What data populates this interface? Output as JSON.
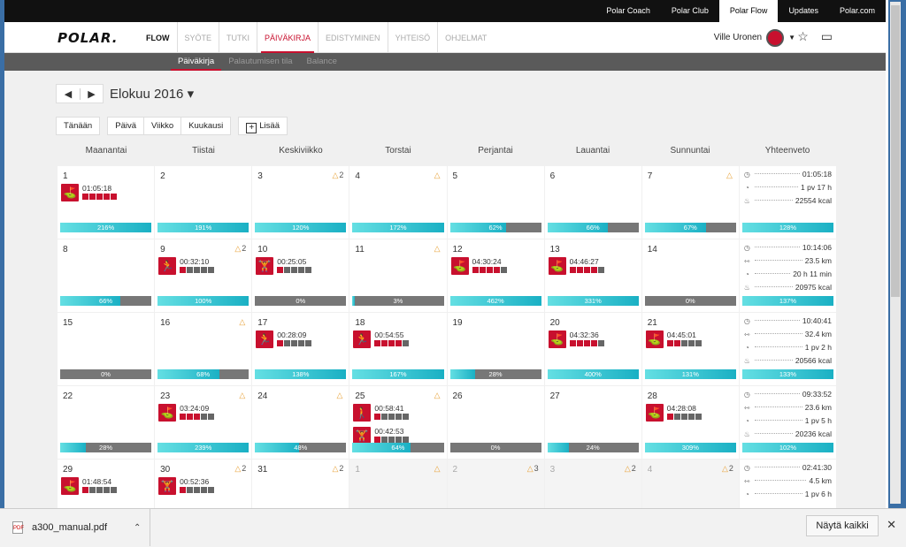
{
  "topbar": {
    "links": [
      {
        "label": "Polar Coach"
      },
      {
        "label": "Polar Club"
      },
      {
        "label": "Polar Flow",
        "active": true
      },
      {
        "label": "Updates"
      },
      {
        "label": "Polar.com"
      }
    ]
  },
  "header": {
    "logo": "POLAR.",
    "nav": [
      {
        "label": "FLOW"
      },
      {
        "label": "SYÖTE"
      },
      {
        "label": "TUTKI"
      },
      {
        "label": "PÄIVÄKIRJA",
        "active": true
      },
      {
        "label": "EDISTYMINEN"
      },
      {
        "label": "YHTEISÖ"
      },
      {
        "label": "OHJELMAT"
      }
    ],
    "user_name": "Ville Uronen"
  },
  "subnav": [
    {
      "label": "Päiväkirja",
      "active": true
    },
    {
      "label": "Palautumisen tila"
    },
    {
      "label": "Balance"
    }
  ],
  "month_title": "Elokuu 2016",
  "controls": {
    "today": "Tänään",
    "day": "Päivä",
    "week": "Viikko",
    "month": "Kuukausi",
    "add": "Lisää"
  },
  "weekdays": [
    "Maanantai",
    "Tiistai",
    "Keskiviikko",
    "Torstai",
    "Perjantai",
    "Lauantai",
    "Sunnuntai"
  ],
  "summary_header": "Yhteenveto",
  "weeks": [
    {
      "days": [
        {
          "day": "1",
          "sessions": [
            {
              "icon": "golf",
              "time": "01:05:18",
              "zones": 5
            }
          ],
          "bar": {
            "label": "216%",
            "fill": 1
          }
        },
        {
          "day": "2",
          "sessions": [],
          "bar": {
            "label": "191%",
            "fill": 1
          }
        },
        {
          "day": "3",
          "tri": "2",
          "sessions": [],
          "bar": {
            "label": "120%",
            "fill": 1
          }
        },
        {
          "day": "4",
          "tri": "",
          "sessions": [],
          "bar": {
            "label": "172%",
            "fill": 1
          }
        },
        {
          "day": "5",
          "sessions": [],
          "bar": {
            "label": "62%",
            "fill": 0.62
          }
        },
        {
          "day": "6",
          "sessions": [],
          "bar": {
            "label": "66%",
            "fill": 0.66
          }
        },
        {
          "day": "7",
          "tri": "",
          "sessions": [],
          "bar": {
            "label": "67%",
            "fill": 0.67
          }
        }
      ],
      "summary": [
        {
          "icon": "clock",
          "value": "01:05:18"
        },
        {
          "icon": "moon",
          "value": "1 pv 17 h"
        },
        {
          "icon": "flame",
          "value": "22554 kcal"
        }
      ],
      "summary_bar": {
        "label": "128%",
        "fill": 1
      }
    },
    {
      "days": [
        {
          "day": "8",
          "sessions": [],
          "bar": {
            "label": "66%",
            "fill": 0.66
          }
        },
        {
          "day": "9",
          "tri": "2",
          "sessions": [
            {
              "icon": "run",
              "time": "00:32:10",
              "zones": 1
            }
          ],
          "bar": {
            "label": "100%",
            "fill": 1
          }
        },
        {
          "day": "10",
          "sessions": [
            {
              "icon": "strength",
              "time": "00:25:05",
              "zones": 1
            }
          ],
          "bar": {
            "label": "0%",
            "fill": 0
          }
        },
        {
          "day": "11",
          "tri": "",
          "sessions": [],
          "bar": {
            "label": "3%",
            "fill": 0.03
          }
        },
        {
          "day": "12",
          "sessions": [
            {
              "icon": "golf",
              "time": "04:30:24",
              "zones": 4
            }
          ],
          "bar": {
            "label": "462%",
            "fill": 1
          }
        },
        {
          "day": "13",
          "sessions": [
            {
              "icon": "golf",
              "time": "04:46:27",
              "zones": 4
            }
          ],
          "bar": {
            "label": "331%",
            "fill": 1
          }
        },
        {
          "day": "14",
          "sessions": [],
          "bar": {
            "label": "0%",
            "fill": 0
          }
        }
      ],
      "summary": [
        {
          "icon": "clock",
          "value": "10:14:06"
        },
        {
          "icon": "distance",
          "value": "23.5 km"
        },
        {
          "icon": "moon",
          "value": "20 h 11 min"
        },
        {
          "icon": "flame",
          "value": "20975 kcal"
        }
      ],
      "summary_bar": {
        "label": "137%",
        "fill": 1
      }
    },
    {
      "days": [
        {
          "day": "15",
          "sessions": [],
          "bar": {
            "label": "0%",
            "fill": 0
          }
        },
        {
          "day": "16",
          "tri": "",
          "sessions": [],
          "bar": {
            "label": "68%",
            "fill": 0.68
          }
        },
        {
          "day": "17",
          "sessions": [
            {
              "icon": "run",
              "time": "00:28:09",
              "zones": 1
            }
          ],
          "bar": {
            "label": "138%",
            "fill": 1
          }
        },
        {
          "day": "18",
          "sessions": [
            {
              "icon": "run",
              "time": "00:54:55",
              "zones": 4
            }
          ],
          "bar": {
            "label": "167%",
            "fill": 1
          }
        },
        {
          "day": "19",
          "sessions": [],
          "bar": {
            "label": "28%",
            "fill": 0.28
          }
        },
        {
          "day": "20",
          "sessions": [
            {
              "icon": "golf",
              "time": "04:32:36",
              "zones": 4
            }
          ],
          "bar": {
            "label": "400%",
            "fill": 1
          }
        },
        {
          "day": "21",
          "sessions": [
            {
              "icon": "golf",
              "time": "04:45:01",
              "zones": 2
            }
          ],
          "bar": {
            "label": "131%",
            "fill": 1
          }
        }
      ],
      "summary": [
        {
          "icon": "clock",
          "value": "10:40:41"
        },
        {
          "icon": "distance",
          "value": "32.4 km"
        },
        {
          "icon": "moon",
          "value": "1 pv 2 h"
        },
        {
          "icon": "flame",
          "value": "20566 kcal"
        }
      ],
      "summary_bar": {
        "label": "133%",
        "fill": 1
      }
    },
    {
      "days": [
        {
          "day": "22",
          "sessions": [],
          "bar": {
            "label": "28%",
            "fill": 0.28
          }
        },
        {
          "day": "23",
          "tri": "",
          "sessions": [
            {
              "icon": "golf",
              "time": "03:24:09",
              "zones": 3
            }
          ],
          "bar": {
            "label": "239%",
            "fill": 1
          }
        },
        {
          "day": "24",
          "tri": "",
          "sessions": [],
          "bar": {
            "label": "48%",
            "fill": 0.48
          }
        },
        {
          "day": "25",
          "tri": "",
          "sessions": [
            {
              "icon": "person",
              "time": "00:58:41",
              "zones": 1
            },
            {
              "icon": "strength",
              "time": "00:42:53",
              "zones": 1
            }
          ],
          "bar": {
            "label": "64%",
            "fill": 0.64
          }
        },
        {
          "day": "26",
          "sessions": [],
          "bar": {
            "label": "0%",
            "fill": 0
          }
        },
        {
          "day": "27",
          "sessions": [],
          "bar": {
            "label": "24%",
            "fill": 0.24
          }
        },
        {
          "day": "28",
          "sessions": [
            {
              "icon": "golf",
              "time": "04:28:08",
              "zones": 1
            }
          ],
          "bar": {
            "label": "309%",
            "fill": 1
          }
        }
      ],
      "summary": [
        {
          "icon": "clock",
          "value": "09:33:52"
        },
        {
          "icon": "distance",
          "value": "23.6 km"
        },
        {
          "icon": "moon",
          "value": "1 pv 5 h"
        },
        {
          "icon": "flame",
          "value": "20236 kcal"
        }
      ],
      "summary_bar": {
        "label": "102%",
        "fill": 1
      }
    },
    {
      "days": [
        {
          "day": "29",
          "sessions": [
            {
              "icon": "golf",
              "time": "01:48:54",
              "zones": 1
            }
          ],
          "bar": null
        },
        {
          "day": "30",
          "tri": "2",
          "sessions": [
            {
              "icon": "strength",
              "time": "00:52:36",
              "zones": 1
            }
          ],
          "bar": null
        },
        {
          "day": "31",
          "tri": "2",
          "sessions": [],
          "bar": null
        },
        {
          "day": "1",
          "other": true,
          "tri": "",
          "sessions": [],
          "bar": null
        },
        {
          "day": "2",
          "other": true,
          "tri": "3",
          "sessions": [],
          "bar": null
        },
        {
          "day": "3",
          "other": true,
          "tri": "2",
          "sessions": [],
          "bar": null
        },
        {
          "day": "4",
          "other": true,
          "tri": "2",
          "sessions": [],
          "bar": null
        }
      ],
      "summary": [
        {
          "icon": "clock",
          "value": "02:41:30"
        },
        {
          "icon": "distance",
          "value": "4.5 km"
        },
        {
          "icon": "moon",
          "value": "1 pv 6 h"
        }
      ],
      "summary_bar": null
    }
  ],
  "download": {
    "file_name": "a300_manual.pdf",
    "show_all": "Näytä kaikki"
  }
}
